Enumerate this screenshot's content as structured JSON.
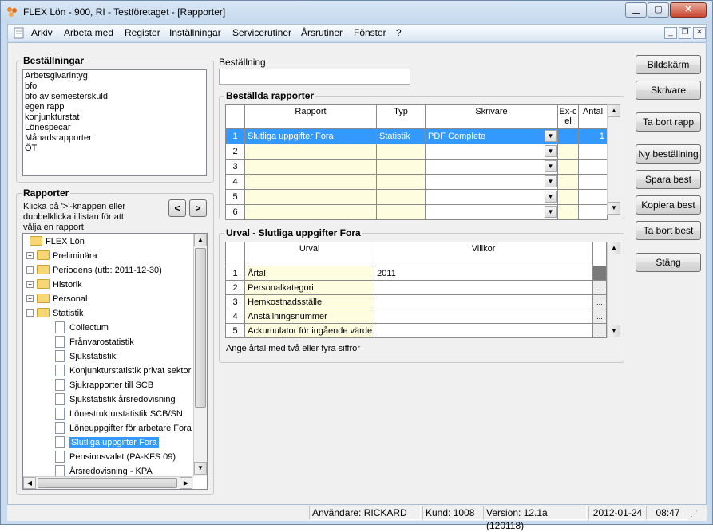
{
  "window": {
    "title": "FLEX Lön - 900, RI - Testföretaget - [Rapporter]"
  },
  "menu": [
    "Arkiv",
    "Arbeta med",
    "Register",
    "Inställningar",
    "Servicerutiner",
    "Årsrutiner",
    "Fönster",
    "?"
  ],
  "orders": {
    "title": "Beställningar",
    "items": [
      "Arbetsgivarintyg",
      "bfo",
      "bfo av semesterskuld",
      "egen rapp",
      "konjunkturstat",
      "Lönespecar",
      "Månadsrapporter",
      "ÖT"
    ]
  },
  "reports": {
    "title": "Rapporter",
    "hint": "Klicka på '>'-knappen eller dubbelklicka i listan för att välja en rapport",
    "prev_label": "<",
    "next_label": ">",
    "tree": [
      {
        "label": "FLEX Lön",
        "type": "folder",
        "level": 0
      },
      {
        "label": "Preliminära",
        "type": "folder",
        "level": 1,
        "toggle": "+"
      },
      {
        "label": "Periodens (utb: 2011-12-30)",
        "type": "folder",
        "level": 1,
        "toggle": "+"
      },
      {
        "label": "Historik",
        "type": "folder",
        "level": 1,
        "toggle": "+"
      },
      {
        "label": "Personal",
        "type": "folder",
        "level": 1,
        "toggle": "+"
      },
      {
        "label": "Statistik",
        "type": "folder",
        "level": 1,
        "toggle": "−"
      },
      {
        "label": "Collectum",
        "type": "doc",
        "level": 2
      },
      {
        "label": "Frånvarostatistik",
        "type": "doc",
        "level": 2
      },
      {
        "label": "Sjukstatistik",
        "type": "doc",
        "level": 2
      },
      {
        "label": "Konjunkturstatistik privat sektor",
        "type": "doc",
        "level": 2
      },
      {
        "label": "Sjukrapporter till SCB",
        "type": "doc",
        "level": 2
      },
      {
        "label": "Sjukstatistik årsredovisning",
        "type": "doc",
        "level": 2
      },
      {
        "label": "Lönestrukturstatistik SCB/SN",
        "type": "doc",
        "level": 2
      },
      {
        "label": "Löneuppgifter för arbetare Fora",
        "type": "doc",
        "level": 2
      },
      {
        "label": "Slutliga uppgifter Fora",
        "type": "doc",
        "level": 2,
        "selected": true
      },
      {
        "label": "Pensionsvalet (PA-KFS 09)",
        "type": "doc",
        "level": 2
      },
      {
        "label": "Årsredovisning - KPA",
        "type": "doc",
        "level": 2
      }
    ]
  },
  "order_field": {
    "label": "Beställning",
    "value": ""
  },
  "ordered_reports": {
    "title": "Beställda rapporter",
    "columns": [
      "Rapport",
      "Typ",
      "Skrivare",
      "Ex-cel",
      "Antal"
    ],
    "rows": [
      {
        "n": "1",
        "rapport": "Slutliga uppgifter Fora",
        "typ": "Statistik",
        "skrivare": "PDF Complete",
        "excel": "",
        "antal": "1"
      },
      {
        "n": "2",
        "rapport": "",
        "typ": "",
        "skrivare": "",
        "excel": "",
        "antal": ""
      },
      {
        "n": "3",
        "rapport": "",
        "typ": "",
        "skrivare": "",
        "excel": "",
        "antal": ""
      },
      {
        "n": "4",
        "rapport": "",
        "typ": "",
        "skrivare": "",
        "excel": "",
        "antal": ""
      },
      {
        "n": "5",
        "rapport": "",
        "typ": "",
        "skrivare": "",
        "excel": "",
        "antal": ""
      },
      {
        "n": "6",
        "rapport": "",
        "typ": "",
        "skrivare": "",
        "excel": "",
        "antal": ""
      }
    ]
  },
  "selection": {
    "title": "Urval - Slutliga uppgifter Fora",
    "columns": [
      "Urval",
      "Villkor"
    ],
    "rows": [
      {
        "n": "1",
        "urval": "Årtal",
        "villkor": "2011"
      },
      {
        "n": "2",
        "urval": "Personalkategori",
        "villkor": ""
      },
      {
        "n": "3",
        "urval": "Hemkostnadsställe",
        "villkor": ""
      },
      {
        "n": "4",
        "urval": "Anställningsnummer",
        "villkor": ""
      },
      {
        "n": "5",
        "urval": "Ackumulator för ingående värde",
        "villkor": ""
      }
    ],
    "hint": "Ange årtal med två eller fyra siffror"
  },
  "buttons": [
    "Bildskärm",
    "Skrivare",
    "Ta bort rapp",
    "Ny beställning",
    "Spara best",
    "Kopiera best",
    "Ta bort best",
    "Stäng"
  ],
  "status": {
    "user": "Användare: RICKARD",
    "client": "Kund: 1008",
    "version": "Version: 12.1a (120118)",
    "date": "2012-01-24",
    "time": "08:47"
  }
}
